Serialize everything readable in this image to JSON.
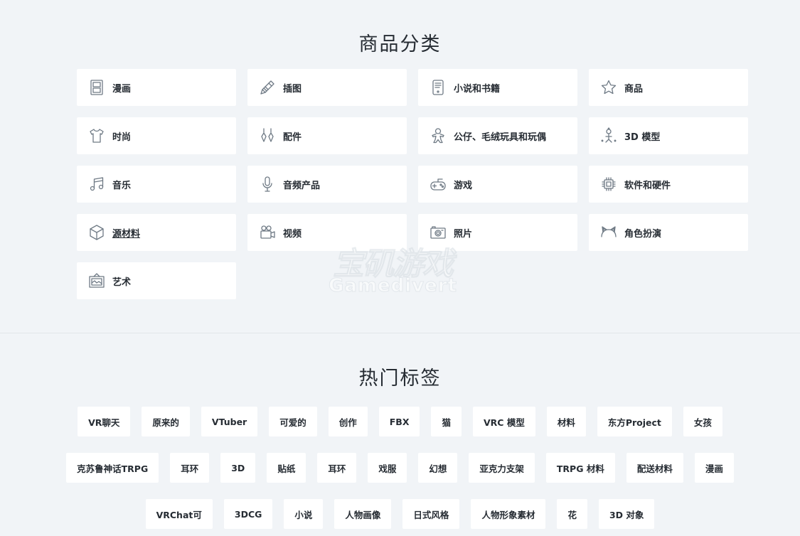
{
  "categories_section": {
    "title": "商品分类",
    "items": [
      {
        "label": "漫画",
        "icon": "comic-book-icon"
      },
      {
        "label": "插图",
        "icon": "pencil-icon"
      },
      {
        "label": "小说和书籍",
        "icon": "book-reader-icon"
      },
      {
        "label": "商品",
        "icon": "star-icon"
      },
      {
        "label": "时尚",
        "icon": "t-shirt-icon"
      },
      {
        "label": "配件",
        "icon": "earrings-icon"
      },
      {
        "label": "公仔、毛绒玩具和玩偶",
        "icon": "gingerbread-doll-icon"
      },
      {
        "label": "3D 模型",
        "icon": "3d-figure-icon"
      },
      {
        "label": "音乐",
        "icon": "music-note-icon"
      },
      {
        "label": "音频产品",
        "icon": "microphone-icon"
      },
      {
        "label": "游戏",
        "icon": "gamepad-icon"
      },
      {
        "label": "软件和硬件",
        "icon": "chip-icon"
      },
      {
        "label": "源材料",
        "icon": "cube-icon"
      },
      {
        "label": "视频",
        "icon": "video-camera-icon"
      },
      {
        "label": "照片",
        "icon": "photo-camera-icon"
      },
      {
        "label": "角色扮演",
        "icon": "cat-ears-icon"
      },
      {
        "label": "艺术",
        "icon": "picture-frame-icon"
      }
    ]
  },
  "tags_section": {
    "title": "热门标签",
    "rows": [
      [
        "VR聊天",
        "原来的",
        "VTuber",
        "可爱的",
        "创作",
        "FBX",
        "猫",
        "VRC 模型",
        "材料",
        "东方Project",
        "女孩"
      ],
      [
        "克苏鲁神话TRPG",
        "耳环",
        "3D",
        "贴纸",
        "耳环",
        "戏服",
        "幻想",
        "亚克力支架",
        "TRPG 材料",
        "配送材料",
        "漫画"
      ],
      [
        "VRChat可",
        "3DCG",
        "小说",
        "人物画像",
        "日式风格",
        "人物形象素材",
        "花",
        "3D 对象"
      ]
    ]
  },
  "watermark": {
    "cn": "宝矶游戏",
    "en": "Gamedivert"
  }
}
